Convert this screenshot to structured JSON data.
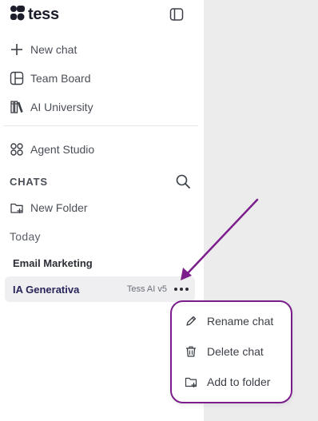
{
  "app": {
    "logo_text": "tess"
  },
  "nav": {
    "new_chat": "New chat",
    "team_board": "Team Board",
    "ai_university": "AI University",
    "agent_studio": "Agent Studio"
  },
  "chats": {
    "header": "CHATS",
    "new_folder": "New Folder",
    "group_label": "Today",
    "items": [
      {
        "title": "Email Marketing"
      },
      {
        "title": "IA Generativa",
        "model": "Tess AI v5"
      }
    ]
  },
  "context_menu": {
    "rename": "Rename chat",
    "delete": "Delete chat",
    "add_to_folder": "Add to folder"
  },
  "colors": {
    "annotation": "#7b1d8a",
    "active_chat_text": "#27255a",
    "main_background": "#ececed"
  },
  "icons": [
    "tess-logo-icon",
    "sidebar-toggle-icon",
    "plus-icon",
    "board-icon",
    "books-icon",
    "grid-icon",
    "search-icon",
    "folder-plus-icon",
    "more-dots-icon",
    "pencil-icon",
    "trash-icon"
  ]
}
